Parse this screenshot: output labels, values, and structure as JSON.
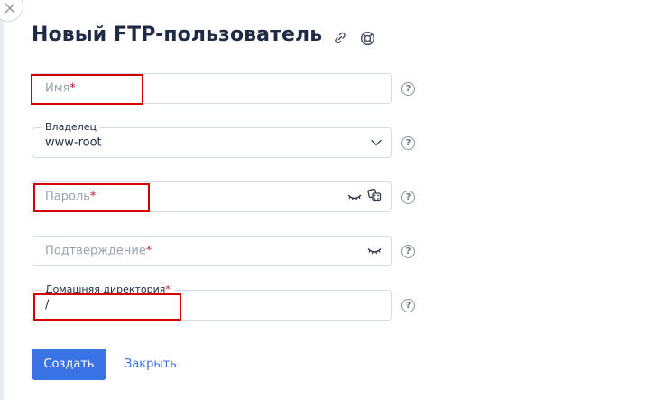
{
  "header": {
    "title": "Новый FTP-пользователь",
    "icons": [
      "link-icon",
      "lifebuoy-icon"
    ]
  },
  "form": {
    "name": {
      "placeholder": "Имя",
      "required_mark": "*"
    },
    "owner": {
      "label": "Владелец",
      "value": "www-root"
    },
    "password": {
      "placeholder": "Пароль",
      "required_mark": "*"
    },
    "confirm": {
      "placeholder": "Подтверждение",
      "required_mark": "*"
    },
    "home_dir": {
      "label": "Домашняя директория",
      "required_mark": "*",
      "value": "/"
    },
    "help_symbol": "?"
  },
  "actions": {
    "create_label": "Создать",
    "close_label": "Закрыть"
  },
  "colors": {
    "primary": "#3a73e6",
    "required": "#c8102e",
    "highlight": "#d40000"
  }
}
